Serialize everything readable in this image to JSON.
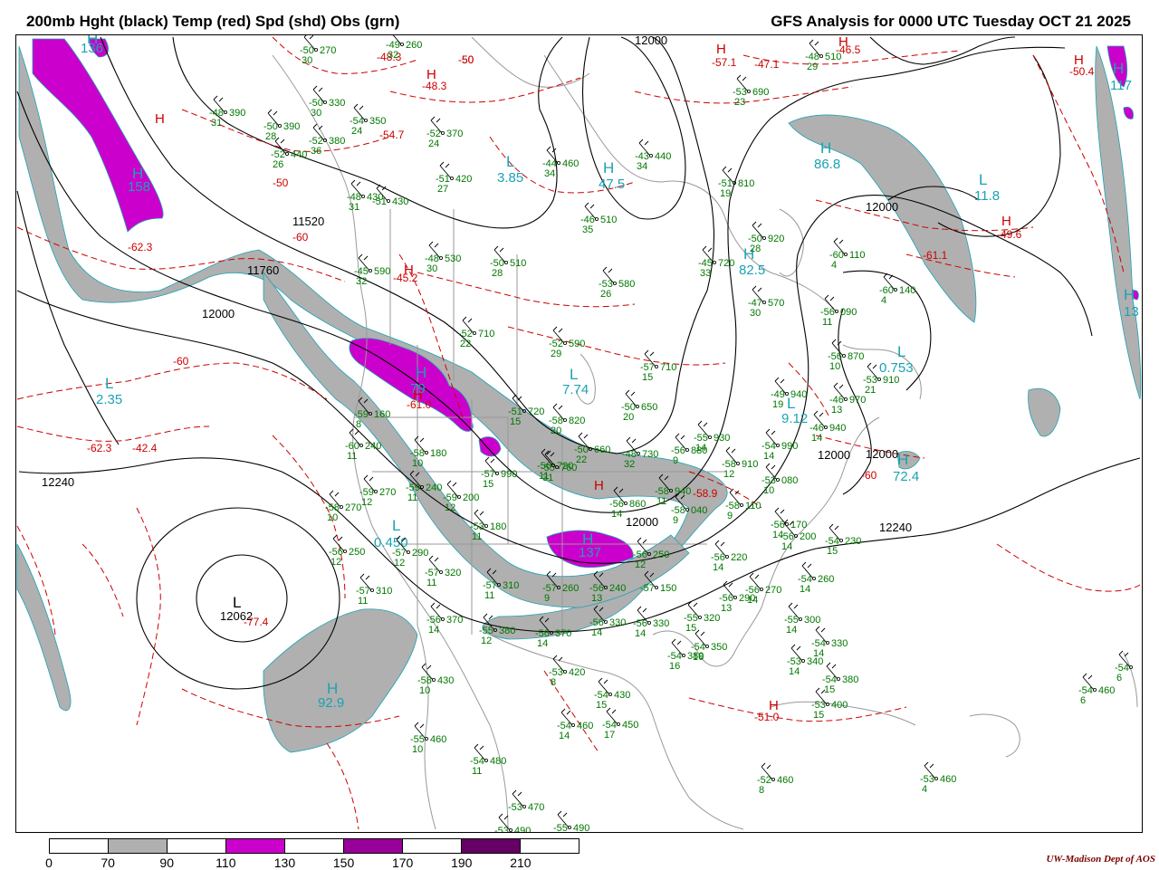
{
  "title_left": "200mb Hght (black) Temp (red) Spd (shd) Obs (grn)",
  "title_right": "GFS Analysis for 0000 UTC Tuesday  OCT 21 2025",
  "credit": "UW-Madison   Dept of AOS",
  "colors": {
    "height": "#000000",
    "temp": "#cc0000",
    "speed_text": "#1aa3b3",
    "obs": "#007700",
    "coast": "#999999",
    "shade_70": "#b0b0b0",
    "shade_110": "#cc00cc",
    "shade_150": "#990099",
    "shade_190": "#660066"
  },
  "legend": {
    "ticks": [
      "0",
      "70",
      "90",
      "110",
      "130",
      "150",
      "170",
      "190",
      "210"
    ],
    "bins": [
      {
        "color": "#ffffff"
      },
      {
        "color": "#b0b0b0"
      },
      {
        "color": "#ffffff"
      },
      {
        "color": "#cc00cc"
      },
      {
        "color": "#ffffff"
      },
      {
        "color": "#990099"
      },
      {
        "color": "#ffffff"
      },
      {
        "color": "#660066"
      },
      {
        "color": "#ffffff"
      }
    ]
  },
  "height_labels": [
    "11520",
    "11760",
    "12000",
    "12240",
    "12000",
    "12240",
    "12000",
    "12062",
    "12000",
    "12000",
    "12000"
  ],
  "temp_labels": [
    "-50",
    "-50",
    "-60",
    "-60",
    "-62.3",
    "-42.4",
    "-62.3",
    "-48.3",
    "-48.3",
    "-54.7",
    "-45.2",
    "-61.0",
    "-47.1",
    "-50",
    "-57.1",
    "-51.0",
    "-58.9",
    "-46.5",
    "-50.4",
    "-61.1",
    "-49.6",
    "-60",
    "-77.4"
  ],
  "speed_labels": [
    {
      "kind": "H",
      "value": "136"
    },
    {
      "kind": "H",
      "value": "158"
    },
    {
      "kind": "L",
      "value": "2.35"
    },
    {
      "kind": "L",
      "value": "3.85"
    },
    {
      "kind": "H",
      "value": "47.5"
    },
    {
      "kind": "H",
      "value": "86.8"
    },
    {
      "kind": "L",
      "value": "11.8"
    },
    {
      "kind": "H",
      "value": "82.5"
    },
    {
      "kind": "H",
      "value": "79"
    },
    {
      "kind": "L",
      "value": "7.74"
    },
    {
      "kind": "L",
      "value": "9.12"
    },
    {
      "kind": "L",
      "value": "0.753"
    },
    {
      "kind": "H",
      "value": "72.4"
    },
    {
      "kind": "L",
      "value": "0.450"
    },
    {
      "kind": "H",
      "value": "92.9"
    },
    {
      "kind": "H",
      "value": "137"
    },
    {
      "kind": "H",
      "value": "117"
    },
    {
      "kind": "H",
      "value": "13"
    }
  ],
  "obs": [
    {
      "t": "-50",
      "h": "270",
      "s": "30"
    },
    {
      "t": "-49",
      "h": "260",
      "s": "32"
    },
    {
      "t": "-48",
      "h": "390",
      "s": "31"
    },
    {
      "t": "-50",
      "h": "330",
      "s": "30"
    },
    {
      "t": "-50",
      "h": "390",
      "s": "28"
    },
    {
      "t": "-54",
      "h": "350",
      "s": "24"
    },
    {
      "t": "-52",
      "h": "380",
      "s": "36"
    },
    {
      "t": "-52",
      "h": "440",
      "s": "26"
    },
    {
      "t": "-52",
      "h": "370",
      "s": "24"
    },
    {
      "t": "-44",
      "h": "460",
      "s": "34"
    },
    {
      "t": "-51",
      "h": "420",
      "s": "27"
    },
    {
      "t": "-48",
      "h": "430",
      "s": "31"
    },
    {
      "t": "-51",
      "h": "430",
      "s": ""
    },
    {
      "t": "-43",
      "h": "440",
      "s": "34"
    },
    {
      "t": "-48",
      "h": "530",
      "s": "30"
    },
    {
      "t": "-50",
      "h": "510",
      "s": "28"
    },
    {
      "t": "-45",
      "h": "590",
      "s": "32"
    },
    {
      "t": "-46",
      "h": "510",
      "s": "35"
    },
    {
      "t": "-53",
      "h": "580",
      "s": "26"
    },
    {
      "t": "-51",
      "h": "810",
      "s": "19"
    },
    {
      "t": "-45",
      "h": "720",
      "s": "33"
    },
    {
      "t": "-50",
      "h": "920",
      "s": "28"
    },
    {
      "t": "-60",
      "h": "110",
      "s": "4"
    },
    {
      "t": "-60",
      "h": "140",
      "s": "4"
    },
    {
      "t": "-47",
      "h": "570",
      "s": "30"
    },
    {
      "t": "-53",
      "h": "690",
      "s": "23"
    },
    {
      "t": "-48",
      "h": "510",
      "s": "29"
    },
    {
      "t": "-57",
      "h": "710",
      "s": "15"
    },
    {
      "t": "-52",
      "h": "590",
      "s": "29"
    },
    {
      "t": "-52",
      "h": "710",
      "s": "22"
    },
    {
      "t": "-56",
      "h": "090",
      "s": "11"
    },
    {
      "t": "-51",
      "h": "720",
      "s": "15"
    },
    {
      "t": "-50",
      "h": "650",
      "s": "20"
    },
    {
      "t": "-56",
      "h": "870",
      "s": "10"
    },
    {
      "t": "-53",
      "h": "910",
      "s": "21"
    },
    {
      "t": "-49",
      "h": "940",
      "s": "19"
    },
    {
      "t": "-46",
      "h": "970",
      "s": "13"
    },
    {
      "t": "-55",
      "h": "930",
      "s": "14"
    },
    {
      "t": "-56",
      "h": "880",
      "s": "9"
    },
    {
      "t": "-54",
      "h": "990",
      "s": "14"
    },
    {
      "t": "-46",
      "h": "940",
      "s": "14"
    },
    {
      "t": "-50",
      "h": "660",
      "s": "22"
    },
    {
      "t": "-48",
      "h": "730",
      "s": "32"
    },
    {
      "t": "-55",
      "h": "760",
      "s": "31"
    },
    {
      "t": "-59",
      "h": "160",
      "s": "8"
    },
    {
      "t": "-60",
      "h": "240",
      "s": "11"
    },
    {
      "t": "-58",
      "h": "180",
      "s": "10"
    },
    {
      "t": "-57",
      "h": "990",
      "s": "15"
    },
    {
      "t": "-56",
      "h": "720",
      "s": "11"
    },
    {
      "t": "-58",
      "h": "940",
      "s": "11"
    },
    {
      "t": "-58",
      "h": "910",
      "s": "12"
    },
    {
      "t": "-53",
      "h": "080",
      "s": "10"
    },
    {
      "t": "-59",
      "h": "270",
      "s": "12"
    },
    {
      "t": "-59",
      "h": "240",
      "s": "11"
    },
    {
      "t": "-59",
      "h": "200",
      "s": "12"
    },
    {
      "t": "-58",
      "h": "270",
      "s": "10"
    },
    {
      "t": "-53",
      "h": "180",
      "s": "11"
    },
    {
      "t": "-56",
      "h": "860",
      "s": "14"
    },
    {
      "t": "-58",
      "h": "040",
      "s": "9"
    },
    {
      "t": "-58",
      "h": "110",
      "s": "9"
    },
    {
      "t": "-56",
      "h": "170",
      "s": "14"
    },
    {
      "t": "-56",
      "h": "200",
      "s": "14"
    },
    {
      "t": "-54",
      "h": "230",
      "s": "15"
    },
    {
      "t": "-56",
      "h": "250",
      "s": "12"
    },
    {
      "t": "-57",
      "h": "290",
      "s": "12"
    },
    {
      "t": "-57",
      "h": "320",
      "s": "11"
    },
    {
      "t": "-57",
      "h": "310",
      "s": "11"
    },
    {
      "t": "-57",
      "h": "260",
      "s": "9"
    },
    {
      "t": "-56",
      "h": "240",
      "s": "13"
    },
    {
      "t": "-56",
      "h": "250",
      "s": "12"
    },
    {
      "t": "-56",
      "h": "220",
      "s": "14"
    },
    {
      "t": "-57",
      "h": "150",
      "s": ""
    },
    {
      "t": "-54",
      "h": "260",
      "s": "14"
    },
    {
      "t": "-56",
      "h": "270",
      "s": "14"
    },
    {
      "t": "-56",
      "h": "290",
      "s": "13"
    },
    {
      "t": "-55",
      "h": "300",
      "s": "14"
    },
    {
      "t": "-57",
      "h": "310",
      "s": "11"
    },
    {
      "t": "-56",
      "h": "370",
      "s": "14"
    },
    {
      "t": "-55",
      "h": "380",
      "s": "12"
    },
    {
      "t": "-56",
      "h": "370",
      "s": "14"
    },
    {
      "t": "-56",
      "h": "330",
      "s": "14"
    },
    {
      "t": "-56",
      "h": "330",
      "s": "14"
    },
    {
      "t": "-55",
      "h": "320",
      "s": "15"
    },
    {
      "t": "-54",
      "h": "350",
      "s": "16"
    },
    {
      "t": "-54",
      "h": "380",
      "s": "16"
    },
    {
      "t": "-54",
      "h": "330",
      "s": "14"
    },
    {
      "t": "-53",
      "h": "340",
      "s": "14"
    },
    {
      "t": "-54",
      "h": "380",
      "s": "15"
    },
    {
      "t": "-53",
      "h": "400",
      "s": "15"
    },
    {
      "t": "-58",
      "h": "430",
      "s": "10"
    },
    {
      "t": "-53",
      "h": "420",
      "s": "8"
    },
    {
      "t": "-54",
      "h": "430",
      "s": "15"
    },
    {
      "t": "-54",
      "h": "460",
      "s": "14"
    },
    {
      "t": "-54",
      "h": "450",
      "s": "17"
    },
    {
      "t": "-55",
      "h": "460",
      "s": "10"
    },
    {
      "t": "-54",
      "h": "480",
      "s": "11"
    },
    {
      "t": "-53",
      "h": "470",
      "s": ""
    },
    {
      "t": "-53",
      "h": "490",
      "s": ""
    },
    {
      "t": "-55",
      "h": "490",
      "s": ""
    },
    {
      "t": "-52",
      "h": "460",
      "s": "8"
    },
    {
      "t": "-53",
      "h": "460",
      "s": "4"
    },
    {
      "t": "-54",
      "h": "460",
      "s": "6"
    },
    {
      "t": "-54",
      "h": "",
      "s": "6"
    },
    {
      "t": "-58",
      "h": "820",
      "s": "20"
    }
  ]
}
